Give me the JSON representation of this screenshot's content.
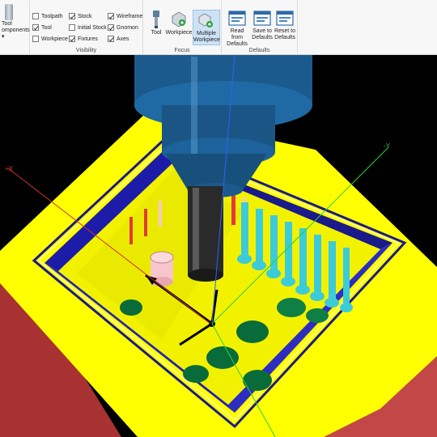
{
  "ribbon": {
    "tool_components": {
      "line1": "Tool",
      "line2": "omponents ▾"
    },
    "visibility": {
      "label": "Visibility",
      "items": [
        {
          "label": "Toolpath",
          "checked": false
        },
        {
          "label": "Tool",
          "checked": true
        },
        {
          "label": "Workpiece",
          "checked": false
        },
        {
          "label": "Stock",
          "checked": true
        },
        {
          "label": "Initial Stock",
          "checked": false
        },
        {
          "label": "Fixtures",
          "checked": true
        },
        {
          "label": "Wireframe",
          "checked": true
        },
        {
          "label": "Gnomon",
          "checked": true
        },
        {
          "label": "Axes",
          "checked": true
        }
      ]
    },
    "focus": {
      "label": "Focus",
      "buttons": [
        {
          "label": "Tool",
          "active": false
        },
        {
          "label": "Workpiece",
          "active": false
        },
        {
          "label_line1": "Multiple",
          "label_line2": "Workpiece",
          "active": true
        }
      ]
    },
    "defaults": {
      "label": "Defaults",
      "buttons": [
        {
          "line1": "Read from",
          "line2": "Defaults"
        },
        {
          "line1": "Save to",
          "line2": "Defaults"
        },
        {
          "line1": "Reset to",
          "line2": "Defaults"
        }
      ]
    }
  },
  "viewport": {
    "axis_labels": {
      "x": "+X",
      "y": "-Y"
    },
    "colors": {
      "background": "#000000",
      "fixture": "#ffff00",
      "workpiece_side": "#b03030",
      "pocket_wall": "#1a1a9a",
      "tool_holder": "#1b5a8c",
      "tool_cutter": "#2a2a2a",
      "holes": "#0a6b3a",
      "pins": "#40c8d8"
    }
  }
}
